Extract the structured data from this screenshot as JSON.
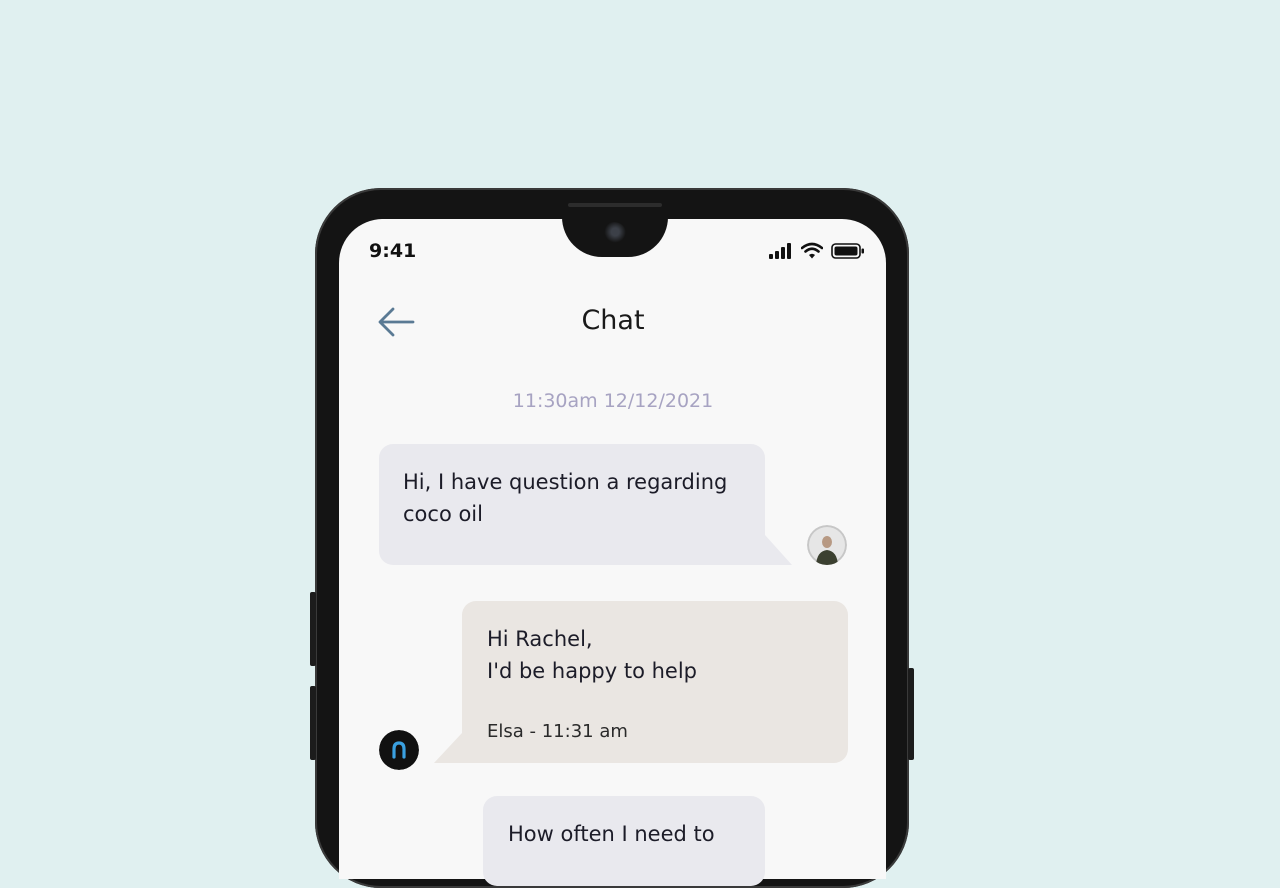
{
  "status_bar": {
    "time": "9:41",
    "icons": [
      "cellular-signal-icon",
      "wifi-icon",
      "battery-icon"
    ]
  },
  "header": {
    "title": "Chat",
    "back_icon": "arrow-left-icon"
  },
  "conversation": {
    "timestamp": "11:30am 12/12/2021",
    "messages": [
      {
        "direction": "incoming",
        "text": "Hi, I have question a regarding coco oil",
        "avatar": "user-photo-avatar"
      },
      {
        "direction": "outgoing",
        "line1": "Hi Rachel,",
        "line2": "I'd be happy to help",
        "meta": "Elsa - 11:31 am",
        "avatar": "brand-logo-avatar"
      },
      {
        "direction": "incoming",
        "text": "How often I need to"
      }
    ]
  },
  "colors": {
    "background": "#e0f0f0",
    "incoming_bubble": "#e9e9ee",
    "outgoing_bubble": "#eae6e2",
    "timestamp": "#a7a3c2",
    "back_arrow": "#5a7a94"
  }
}
